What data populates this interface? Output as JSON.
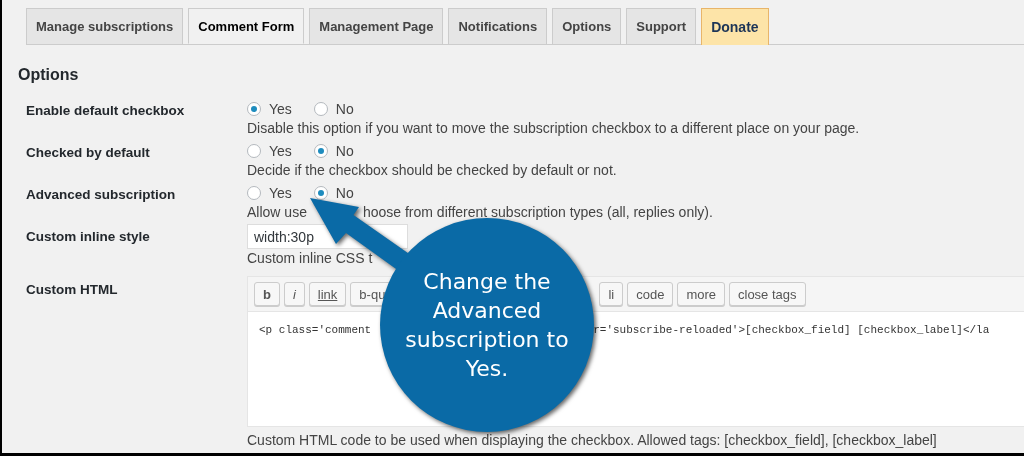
{
  "tabs": [
    {
      "kind": "tab",
      "label": "Manage subscriptions",
      "selected": false
    },
    {
      "kind": "tab",
      "label": "Comment Form",
      "selected": true
    },
    {
      "kind": "tab",
      "label": "Management Page",
      "selected": false
    },
    {
      "kind": "tab",
      "label": "Notifications",
      "selected": false
    },
    {
      "kind": "tab",
      "label": "Options",
      "selected": false
    },
    {
      "kind": "tab",
      "label": "Support",
      "selected": false
    },
    {
      "kind": "donate",
      "label": "Donate",
      "selected": false
    }
  ],
  "section_title": "Options",
  "settings": [
    {
      "kind": "radio",
      "label": "Enable default checkbox",
      "options": [
        {
          "label": "Yes",
          "selected": true
        },
        {
          "label": "No",
          "selected": false
        }
      ],
      "description": [
        "Disable this option if you want to move the subscription checkbox to a different place on your page."
      ]
    },
    {
      "kind": "radio",
      "label": "Checked by default",
      "options": [
        {
          "label": "Yes",
          "selected": false
        },
        {
          "label": "No",
          "selected": true
        }
      ],
      "description": [
        "Decide if the checkbox should be checked by default or not."
      ]
    },
    {
      "kind": "radio",
      "label": "Advanced subscription",
      "options": [
        {
          "label": "Yes",
          "selected": false
        },
        {
          "label": "No",
          "selected": true
        }
      ],
      "description": [
        "Allow use",
        "hoose from different subscription types (all, replies only)."
      ]
    },
    {
      "kind": "text",
      "label": "Custom inline style",
      "value": "width:30p",
      "description": [
        "Custom inline CSS t"
      ]
    },
    {
      "kind": "editor",
      "label": "Custom HTML",
      "toolbar": [
        "b",
        "i",
        "link",
        "b-qu",
        "li",
        "code",
        "more",
        "close tags"
      ],
      "code": [
        "<p class='comment",
        "r='subscribe-reloaded'>[checkbox_field] [checkbox_label]</la"
      ],
      "description": [
        "Custom HTML code to be used when displaying the checkbox. Allowed tags: [checkbox_field], [checkbox_label]"
      ]
    }
  ],
  "callout": {
    "lines": [
      "Change the",
      "Advanced",
      "subscription to",
      "Yes."
    ]
  }
}
